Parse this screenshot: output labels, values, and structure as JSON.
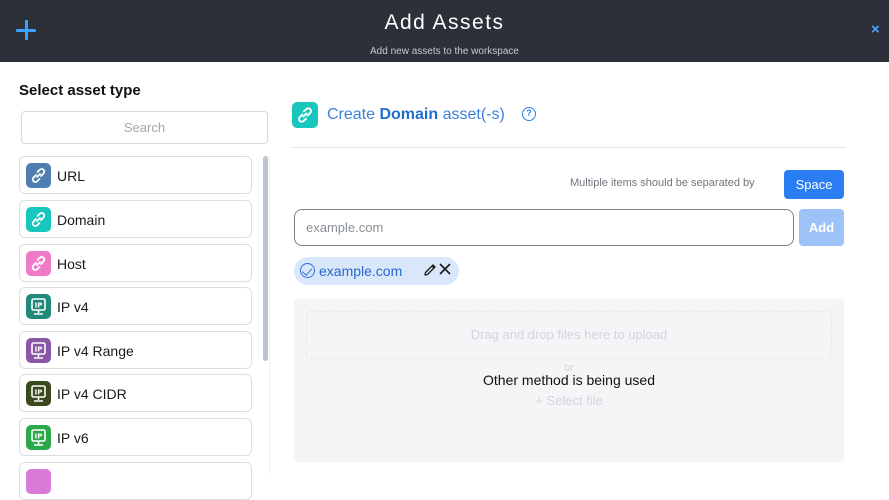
{
  "header": {
    "title": "Add Assets",
    "subtitle": "Add new assets to the workspace",
    "close_symbol": "×"
  },
  "left_panel": {
    "title": "Select asset type",
    "search_placeholder": "Search",
    "items": [
      {
        "label": "URL",
        "icon": "link-icon",
        "color": "#4f7fb0"
      },
      {
        "label": "Domain",
        "icon": "link-icon",
        "color": "#17c7be"
      },
      {
        "label": "Host",
        "icon": "link-icon",
        "color": "#f07ac8"
      },
      {
        "label": "IP v4",
        "icon": "ip-icon",
        "color": "#1f8a7a"
      },
      {
        "label": "IP v4 Range",
        "icon": "ip-icon",
        "color": "#8a57a6"
      },
      {
        "label": "IP v4 CIDR",
        "icon": "ip-icon",
        "color": "#3b4a1d"
      },
      {
        "label": "IP v6",
        "icon": "ip-icon",
        "color": "#2aa84a"
      }
    ]
  },
  "main": {
    "create_prefix": "Create ",
    "create_type": "Domain",
    "create_suffix": " asset(-s)",
    "help_symbol": "?",
    "separator_note": "Multiple items should be separated by",
    "separator_button": "Space",
    "input_placeholder": "example.com",
    "add_button": "Add",
    "chip_value": "example.com",
    "upload": {
      "drag_text": "Drag and drop files here to upload",
      "or_text": "or",
      "select_text": "Select file",
      "status_text": "Other method is being used"
    }
  },
  "colors": {
    "header_bg": "#2b3039",
    "accent": "#2b7ef2",
    "domain_icon": "#17c7be"
  }
}
